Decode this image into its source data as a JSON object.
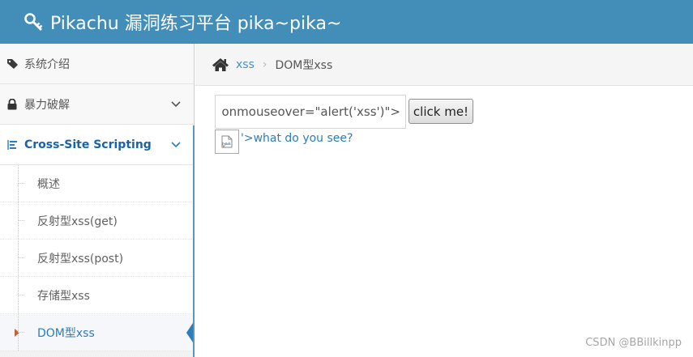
{
  "header": {
    "title": "Pikachu 漏洞练习平台 pika~pika~",
    "icon": "key-icon"
  },
  "sidebar": {
    "items": [
      {
        "label": "系统介绍",
        "icon": "tags-icon"
      },
      {
        "label": "暴力破解",
        "icon": "lock-icon",
        "chevron": "chevron-down-icon"
      },
      {
        "label": "Cross-Site Scripting",
        "icon": "list-icon",
        "chevron": "chevron-down-icon"
      }
    ],
    "subitems": [
      {
        "label": "概述"
      },
      {
        "label": "反射型xss(get)"
      },
      {
        "label": "反射型xss(post)"
      },
      {
        "label": "存储型xss"
      },
      {
        "label": "DOM型xss"
      }
    ]
  },
  "breadcrumb": {
    "home_icon": "home-icon",
    "link": "xss",
    "separator": "›",
    "current": "DOM型xss"
  },
  "main": {
    "input_value": "onmouseover=\"alert('xss')\">",
    "button_label": "click me!",
    "result_text": "'>what do you see?"
  },
  "watermark": "CSDN @BBillkinpp",
  "colors": {
    "header": "#438eb9",
    "accent": "#2b7dbc",
    "active_caret": "#c86139"
  }
}
